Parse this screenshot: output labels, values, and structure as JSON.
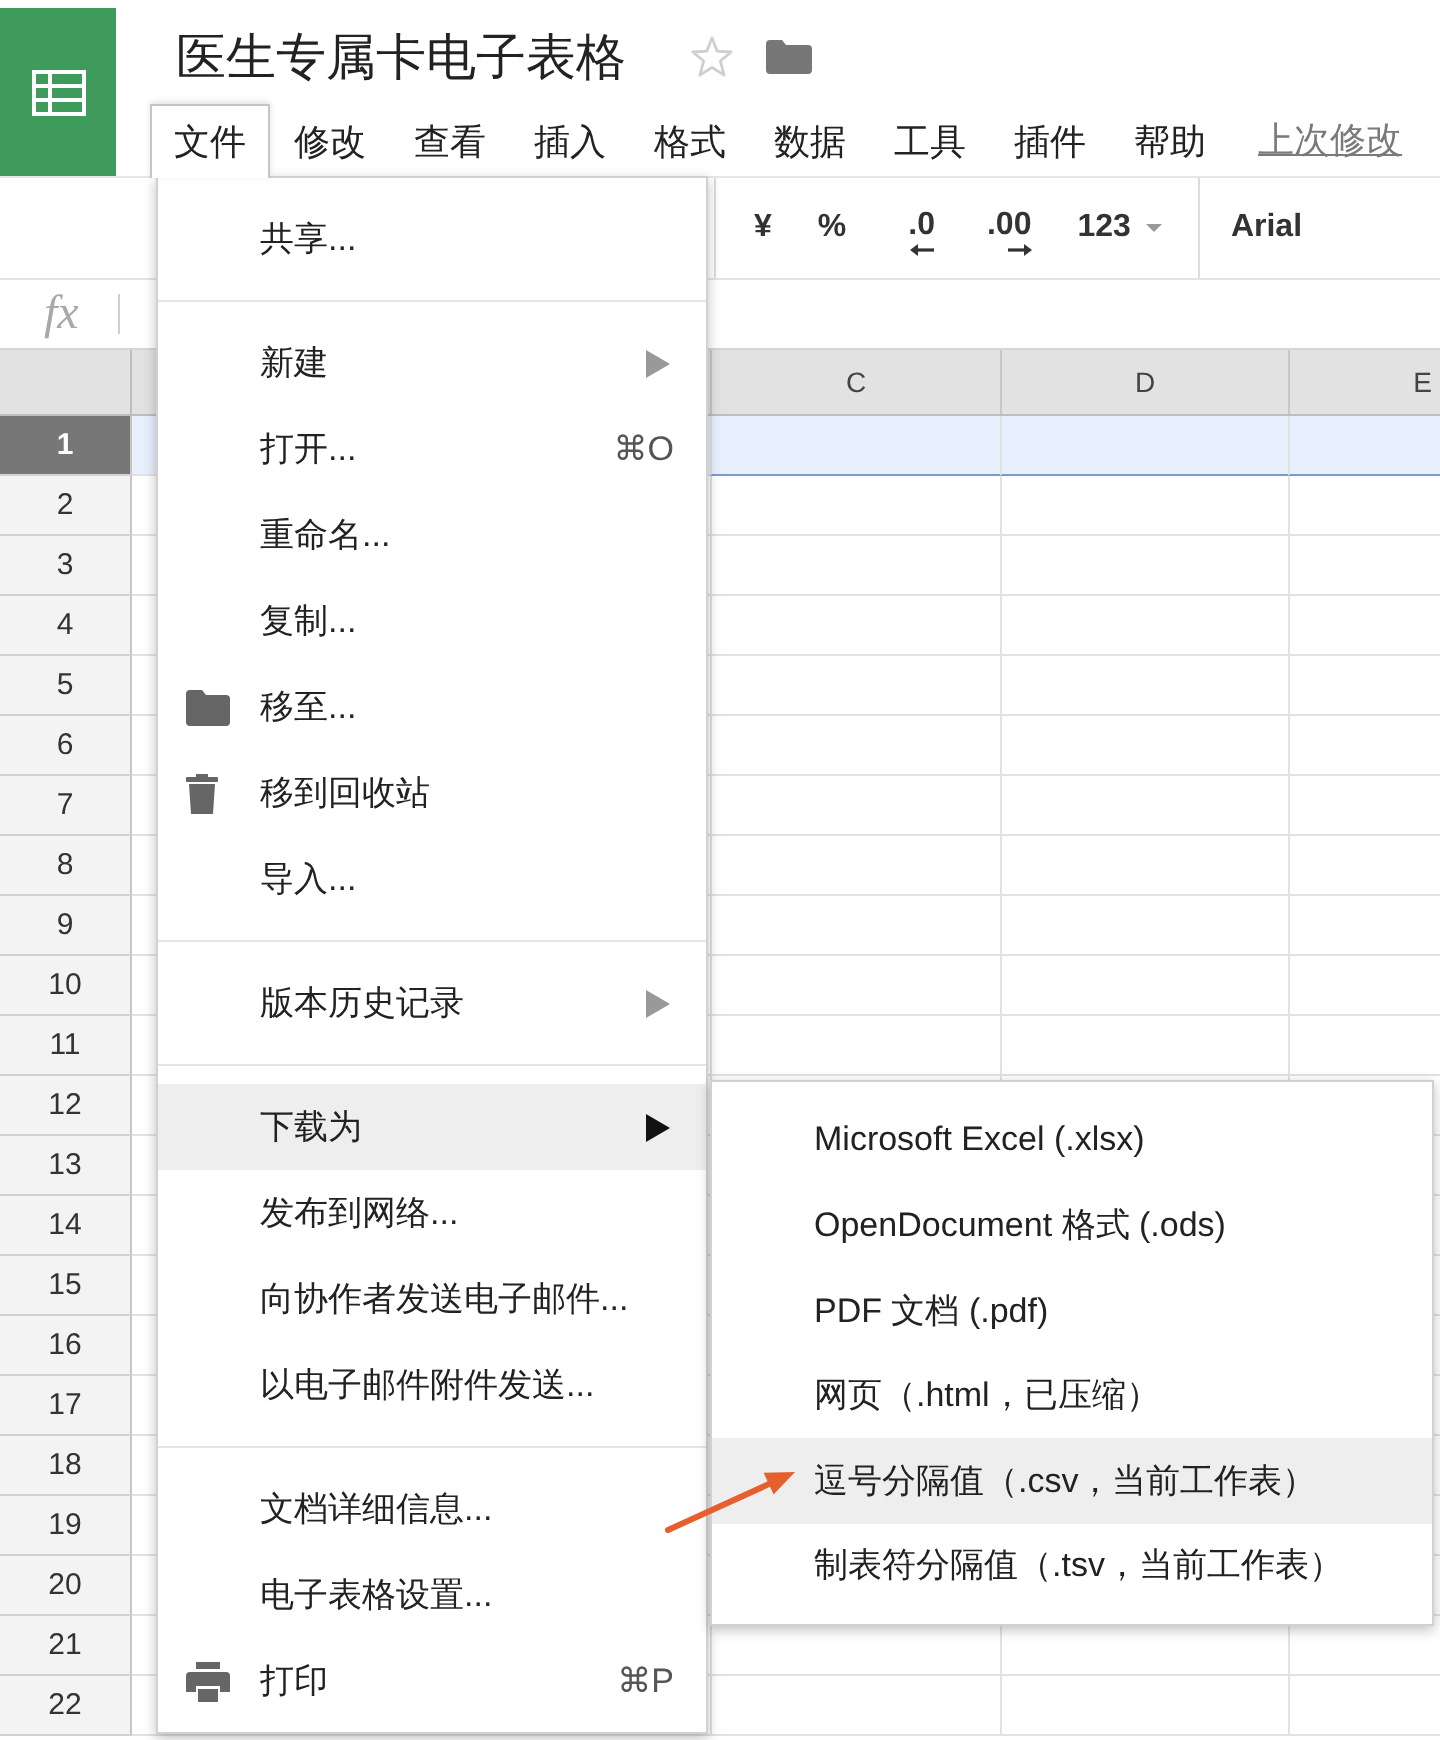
{
  "header": {
    "title": "医生专属卡电子表格",
    "starred": false
  },
  "menu_bar": {
    "items": [
      {
        "label": "文件",
        "selected": true
      },
      {
        "label": "修改",
        "selected": false
      },
      {
        "label": "查看",
        "selected": false
      },
      {
        "label": "插入",
        "selected": false
      },
      {
        "label": "格式",
        "selected": false
      },
      {
        "label": "数据",
        "selected": false
      },
      {
        "label": "工具",
        "selected": false
      },
      {
        "label": "插件",
        "selected": false
      },
      {
        "label": "帮助",
        "selected": false
      }
    ],
    "last_edit_link": "上次修改"
  },
  "toolbar": {
    "items": [
      {
        "kind": "currency",
        "label": "¥"
      },
      {
        "kind": "percent",
        "label": "%"
      },
      {
        "kind": "decimal_less",
        "label": ".0"
      },
      {
        "kind": "decimal_more",
        "label": ".00"
      },
      {
        "kind": "number_format",
        "label": "123"
      },
      {
        "kind": "font",
        "label": "Arial"
      }
    ]
  },
  "formula_bar": {
    "label": "fx"
  },
  "sheet": {
    "columns": [
      "C",
      "D",
      "E"
    ],
    "rows": [
      {
        "number": "1",
        "selected": true
      },
      {
        "number": "2",
        "selected": false
      },
      {
        "number": "3",
        "selected": false
      },
      {
        "number": "4",
        "selected": false
      },
      {
        "number": "5",
        "selected": false
      },
      {
        "number": "6",
        "selected": false
      },
      {
        "number": "7",
        "selected": false
      },
      {
        "number": "8",
        "selected": false
      },
      {
        "number": "9",
        "selected": false
      },
      {
        "number": "10",
        "selected": false
      },
      {
        "number": "11",
        "selected": false
      },
      {
        "number": "12",
        "selected": false
      },
      {
        "number": "13",
        "selected": false
      },
      {
        "number": "14",
        "selected": false
      },
      {
        "number": "15",
        "selected": false
      },
      {
        "number": "16",
        "selected": false
      },
      {
        "number": "17",
        "selected": false
      },
      {
        "number": "18",
        "selected": false
      },
      {
        "number": "19",
        "selected": false
      },
      {
        "number": "20",
        "selected": false
      },
      {
        "number": "21",
        "selected": false
      },
      {
        "number": "22",
        "selected": false
      }
    ]
  },
  "file_menu": {
    "sections": [
      {
        "items": [
          {
            "kind": "plain",
            "label": "共享...",
            "submenu": false,
            "highlighted": false
          }
        ]
      },
      {
        "items": [
          {
            "kind": "plain",
            "label": "新建",
            "submenu": true,
            "highlighted": false
          },
          {
            "kind": "plain",
            "label": "打开...",
            "shortcut": "⌘O",
            "submenu": false,
            "highlighted": false
          },
          {
            "kind": "plain",
            "label": "重命名...",
            "submenu": false,
            "highlighted": false
          },
          {
            "kind": "plain",
            "label": "复制...",
            "submenu": false,
            "highlighted": false
          },
          {
            "kind": "move",
            "label": "移至...",
            "submenu": false,
            "highlighted": false
          },
          {
            "kind": "trash",
            "label": "移到回收站",
            "submenu": false,
            "highlighted": false
          },
          {
            "kind": "plain",
            "label": "导入...",
            "submenu": false,
            "highlighted": false
          }
        ]
      },
      {
        "items": [
          {
            "kind": "plain",
            "label": "版本历史记录",
            "submenu": true,
            "highlighted": false
          }
        ]
      },
      {
        "items": [
          {
            "kind": "plain",
            "label": "下载为",
            "submenu": true,
            "highlighted": true
          },
          {
            "kind": "plain",
            "label": "发布到网络...",
            "submenu": false,
            "highlighted": false
          },
          {
            "kind": "plain",
            "label": "向协作者发送电子邮件...",
            "submenu": false,
            "highlighted": false
          },
          {
            "kind": "plain",
            "label": "以电子邮件附件发送...",
            "submenu": false,
            "highlighted": false
          }
        ]
      },
      {
        "items": [
          {
            "kind": "plain",
            "label": "文档详细信息...",
            "submenu": false,
            "highlighted": false
          },
          {
            "kind": "plain",
            "label": "电子表格设置...",
            "submenu": false,
            "highlighted": false
          },
          {
            "kind": "print",
            "label": "打印",
            "shortcut": "⌘P",
            "submenu": false,
            "highlighted": false
          }
        ]
      }
    ]
  },
  "download_submenu": {
    "items": [
      {
        "label": "Microsoft Excel (.xlsx)",
        "highlighted": false,
        "arrow": false
      },
      {
        "label": "OpenDocument 格式 (.ods)",
        "highlighted": false,
        "arrow": false
      },
      {
        "label": "PDF 文档 (.pdf)",
        "highlighted": false,
        "arrow": false
      },
      {
        "label": "网页（.html，已压缩）",
        "highlighted": false,
        "arrow": false
      },
      {
        "label": "逗号分隔值（.csv，当前工作表）",
        "highlighted": true,
        "arrow": true
      },
      {
        "label": "制表符分隔值（.tsv，当前工作表）",
        "highlighted": false,
        "arrow": false
      }
    ]
  }
}
